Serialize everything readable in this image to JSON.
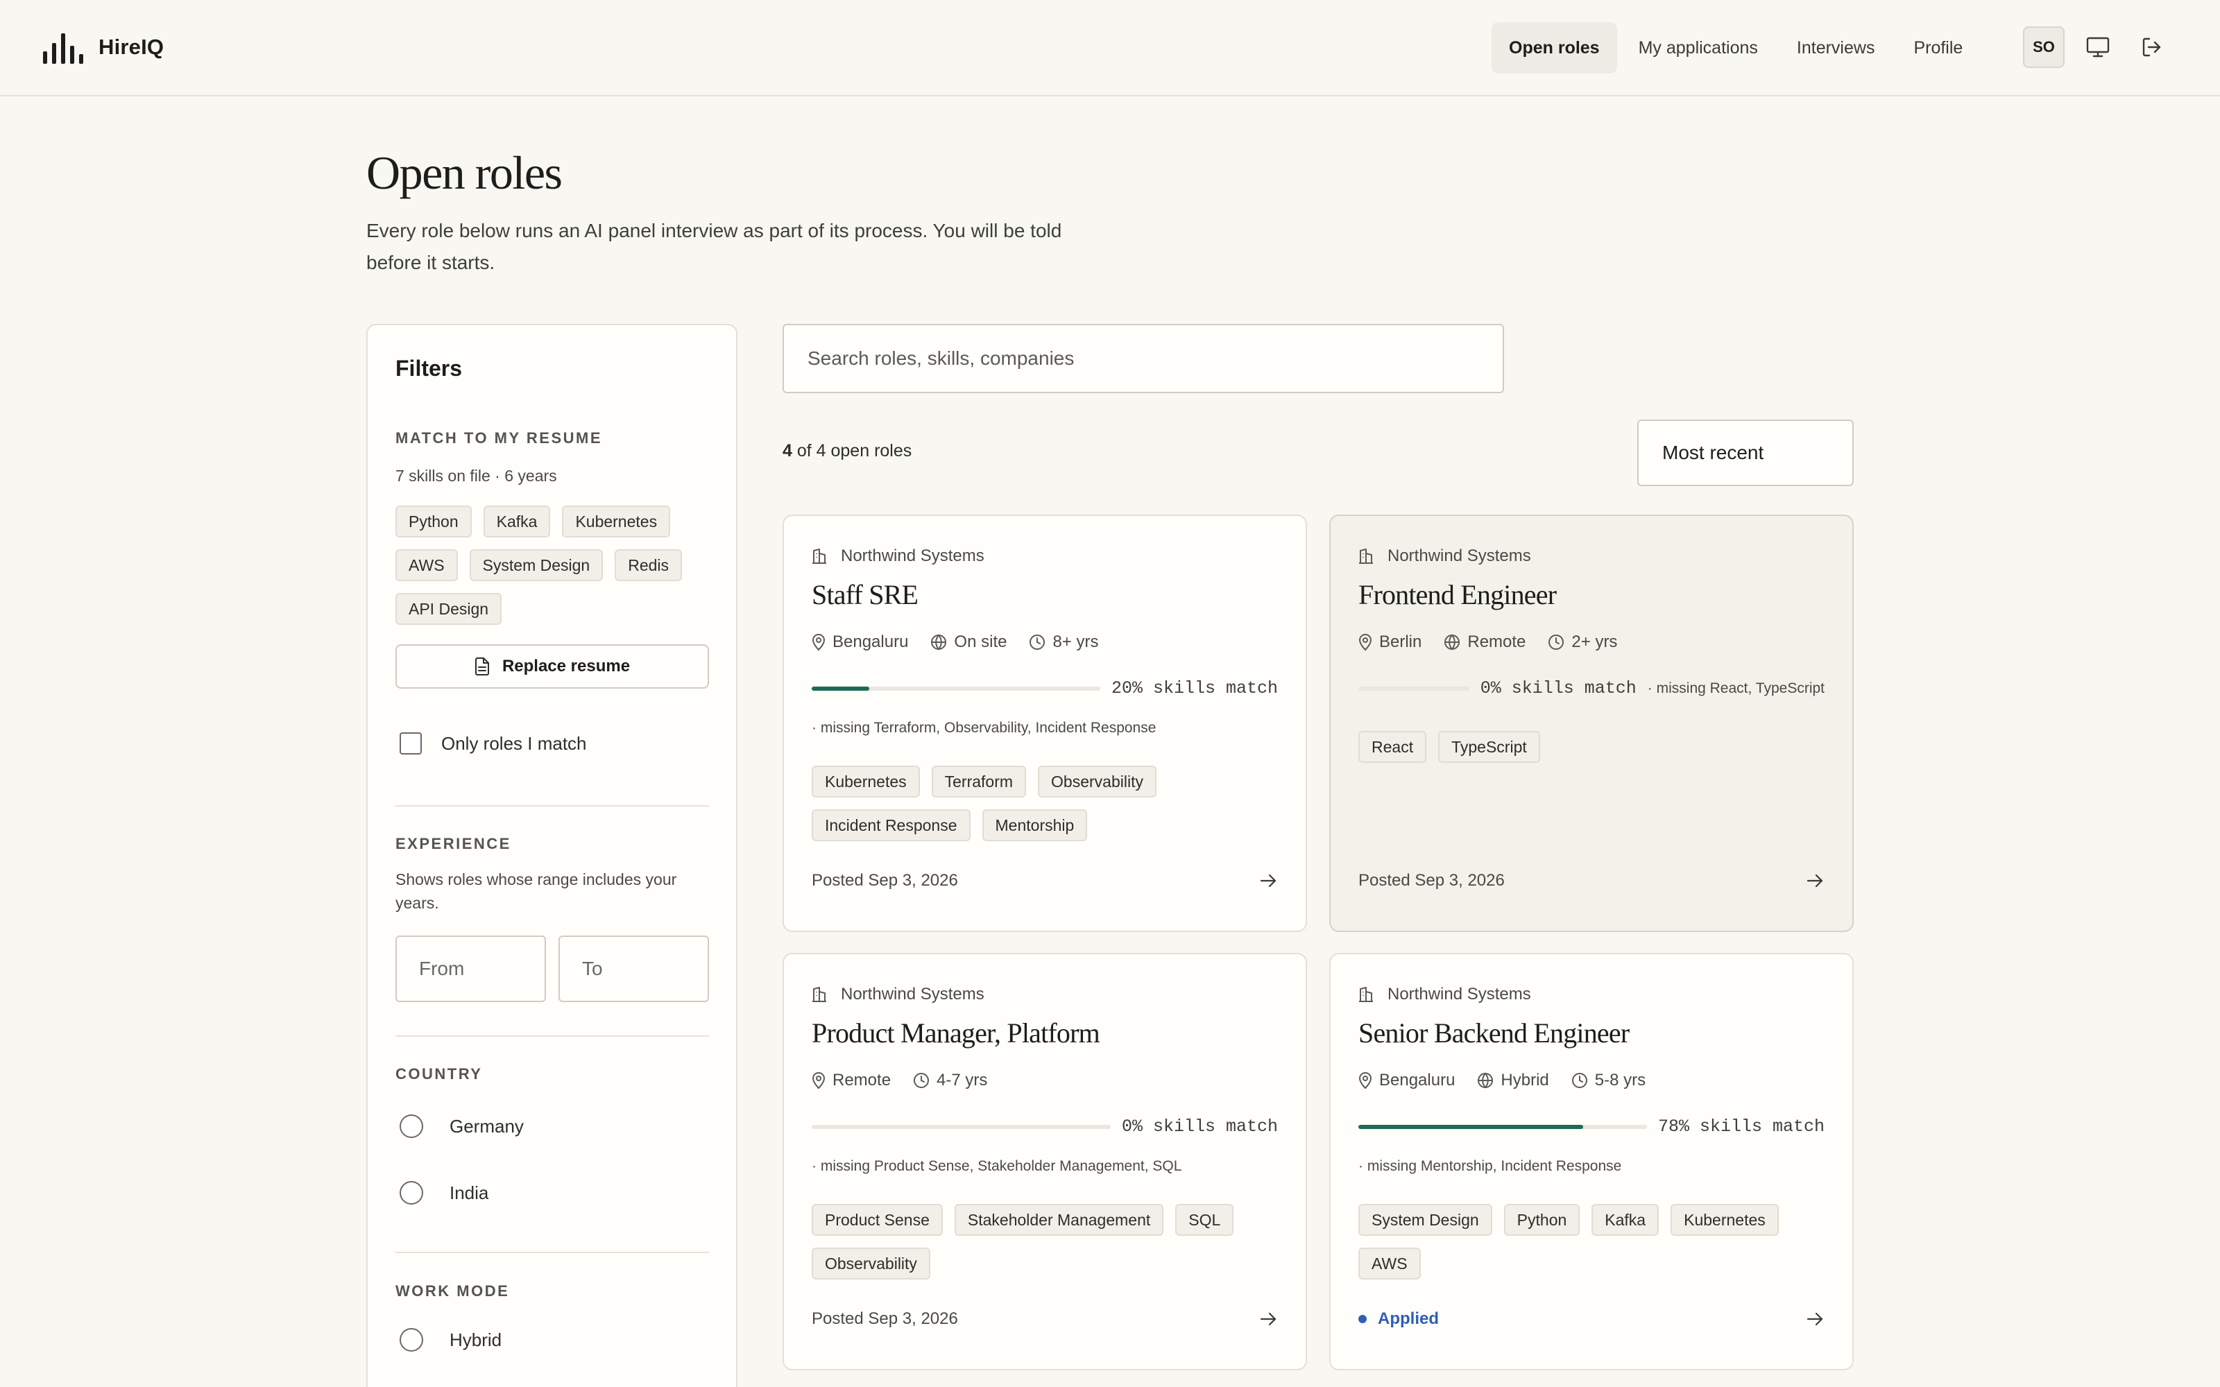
{
  "header": {
    "brand": "HireIQ",
    "nav": [
      {
        "label": "Open roles",
        "active": true
      },
      {
        "label": "My applications",
        "active": false
      },
      {
        "label": "Interviews",
        "active": false
      },
      {
        "label": "Profile",
        "active": false
      }
    ],
    "avatar_initials": "SO",
    "icons": [
      "monitor-icon",
      "logout-icon"
    ]
  },
  "page": {
    "title": "Open roles",
    "subtitle": "Every role below runs an AI panel interview as part of its process. You will be told before it starts."
  },
  "filters": {
    "title": "Filters",
    "resume": {
      "label": "MATCH TO MY RESUME",
      "summary": "7 skills on file · 6 years",
      "skills": [
        "Python",
        "Kafka",
        "Kubernetes",
        "AWS",
        "System Design",
        "Redis",
        "API Design"
      ],
      "replace_label": "Replace resume",
      "only_match_label": "Only roles I match"
    },
    "experience": {
      "label": "EXPERIENCE",
      "note": "Shows roles whose range includes your years.",
      "from_placeholder": "From",
      "to_placeholder": "To"
    },
    "country": {
      "label": "COUNTRY",
      "options": [
        "Germany",
        "India"
      ]
    },
    "work_mode": {
      "label": "WORK MODE",
      "options": [
        "Hybrid"
      ]
    }
  },
  "main": {
    "search_placeholder": "Search roles, skills, companies",
    "count_shown": "4",
    "count_rest": "of 4 open roles",
    "sort_value": "Most recent"
  },
  "accent_color": "#1d6b55",
  "applied_color": "#2f5fb5",
  "roles": [
    {
      "company": "Northwind Systems",
      "title": "Staff SRE",
      "location": "Bengaluru",
      "mode": "On site",
      "experience": "8+ yrs",
      "match_pct": 20,
      "match_label": "20% skills match",
      "missing": "· missing Terraform, Observability, Incident Response",
      "skills": [
        "Kubernetes",
        "Terraform",
        "Observability",
        "Incident Response",
        "Mentorship"
      ],
      "footer": "Posted Sep 3, 2026",
      "applied": false
    },
    {
      "company": "Northwind Systems",
      "title": "Frontend Engineer",
      "location": "Berlin",
      "mode": "Remote",
      "experience": "2+ yrs",
      "match_pct": 0,
      "match_label": "0% skills match",
      "missing": "· missing React, TypeScript",
      "skills": [
        "React",
        "TypeScript"
      ],
      "footer": "Posted Sep 3, 2026",
      "applied": false
    },
    {
      "company": "Northwind Systems",
      "title": "Product Manager, Platform",
      "location": "Remote",
      "mode": "",
      "experience": "4-7 yrs",
      "match_pct": 0,
      "match_label": "0% skills match",
      "missing": "· missing Product Sense, Stakeholder Management, SQL",
      "skills": [
        "Product Sense",
        "Stakeholder Management",
        "SQL",
        "Observability"
      ],
      "footer": "Posted Sep 3, 2026",
      "applied": false
    },
    {
      "company": "Northwind Systems",
      "title": "Senior Backend Engineer",
      "location": "Bengaluru",
      "mode": "Hybrid",
      "experience": "5-8 yrs",
      "match_pct": 78,
      "match_label": "78% skills match",
      "missing": "· missing Mentorship, Incident Response",
      "skills": [
        "System Design",
        "Python",
        "Kafka",
        "Kubernetes",
        "AWS"
      ],
      "footer": "Applied",
      "applied": true
    }
  ]
}
